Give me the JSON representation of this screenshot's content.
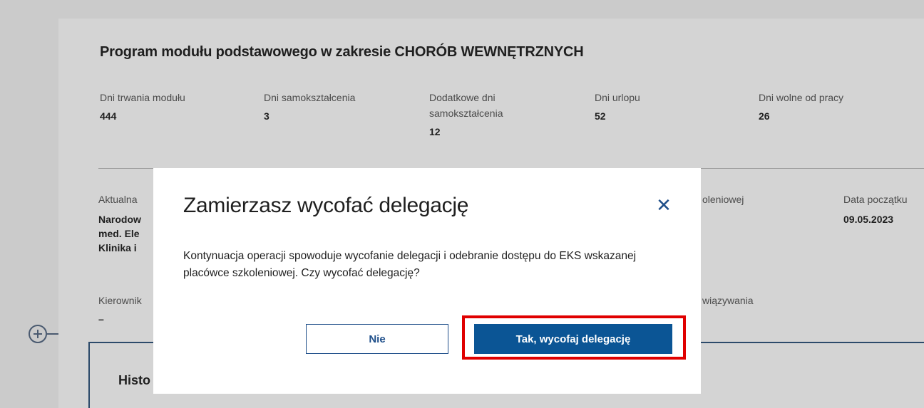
{
  "background": {
    "section_title": "Program modułu podstawowego w zakresie CHORÓB WEWNĘTRZNYCH",
    "stats": [
      {
        "label": "Dni trwania modułu",
        "value": "444"
      },
      {
        "label": "Dni samokształcenia",
        "value": "3"
      },
      {
        "label": "Dodatkowe dni samokształcenia",
        "value": "12"
      },
      {
        "label": "Dni urlopu",
        "value": "52"
      },
      {
        "label": "Dni wolne od pracy",
        "value": "26"
      }
    ],
    "current_label": "Aktualna",
    "current_lines": [
      "Narodow",
      "med. Ele",
      "Klinika i"
    ],
    "training_label": "oleniowej",
    "start_date_label": "Data początku",
    "start_date_value": "09.05.2023",
    "manager_label": "Kierownik",
    "manager_value": "–",
    "binding_label": "wiązywania",
    "history_title": "Histo"
  },
  "modal": {
    "title": "Zamierzasz wycofać delegację",
    "close_symbol": "✕",
    "body": "Kontynuacja operacji spowoduje wycofanie delegacji i odebranie dostępu do EKS wskazanej placówce szkoleniowej. Czy wycofać delegację?",
    "cancel_label": "Nie",
    "confirm_label": "Tak, wycofaj delegację"
  },
  "colors": {
    "primary": "#0b5595",
    "highlight": "#e00000",
    "overlay": "#cbcbcb"
  }
}
